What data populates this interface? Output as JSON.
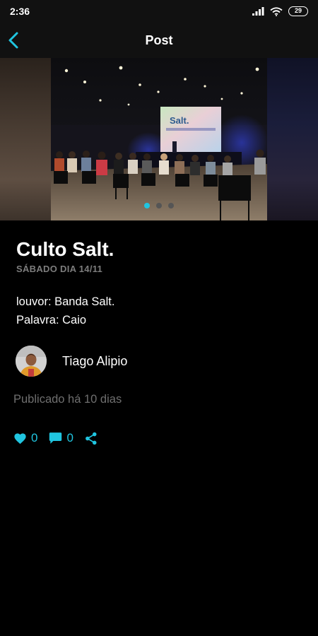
{
  "status_bar": {
    "time": "2:36",
    "battery": "29"
  },
  "app_bar": {
    "title": "Post"
  },
  "carousel": {
    "image_count": 3,
    "active_index": 0,
    "screen_text": "Salt."
  },
  "post": {
    "title": "Culto Salt.",
    "date": "SÁBADO DIA 14/11",
    "body_lines": [
      "louvor: Banda Salt.",
      "Palavra: Caio"
    ]
  },
  "author": {
    "name": "Tiago Alipio"
  },
  "published": "Publicado há 10 dias",
  "actions": {
    "likes": "0",
    "comments": "0"
  },
  "colors": {
    "accent": "#20c5e0",
    "background": "#000000",
    "muted": "#7d7d7d"
  },
  "icons": {
    "back": "chevron-left-icon",
    "like": "heart-icon",
    "comment": "chat-bubble-icon",
    "share": "share-icon",
    "signal": "signal-icon",
    "wifi": "wifi-icon",
    "battery": "battery-icon"
  }
}
